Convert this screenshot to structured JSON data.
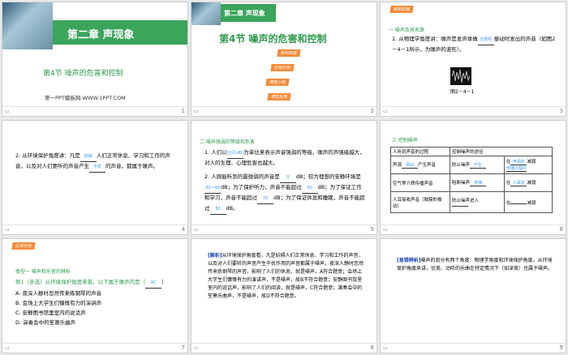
{
  "slides": [
    {
      "num": "1",
      "chapter": "第二章  声现象",
      "section": "第4节   噪声的危害和控制",
      "site": "第一PPT模板网-WWW.1PPT.COM"
    },
    {
      "num": "2",
      "chapter": "第二章 声现象",
      "section": "第4节    噪声的危害和控制",
      "tags": [
        "新知梳理",
        "应用示例",
        "课堂小结",
        "课堂反馈"
      ]
    },
    {
      "num": "3",
      "tag": "新知梳理",
      "subtitle": "一  噪声及其来源",
      "text1": "1. 从物理学角度讲：噪声是发声体做",
      "blank1": "无规则",
      "text2": "振动时发出的声音（如图2－4－1所示，为噪声的波形）。",
      "caption": "图2－4－1"
    },
    {
      "num": "4",
      "text1": "2. 从环境保护角度讲：凡是",
      "blank1": "妨碍",
      "text2": "人们正常休息、学习和工作的声音，以及对人们要听的声音产生",
      "blank2": "干扰",
      "text3": "的声音，都属于噪声。"
    },
    {
      "num": "5",
      "subtitle": "二  噪声强弱的等级和危害",
      "p1a": "1. 人们以",
      "p1b": "分贝(dB)",
      "p1c": "为单位来表示声音强弱的等级，噪声的声强级越大，对人的生理、心理危害也越大。",
      "p2a": "2. 人刚能听到的最微弱的声音是",
      "p2b": "0",
      "p2c": "dB；较为理想的安静环境是",
      "p2d": "30～40",
      "p2e": "dB；为了保护听力，声音不能超过",
      "p2f": "90",
      "p2g": "dB；为了保证工作和学习，声音不能超过",
      "p2h": "70",
      "p2i": "dB；为了保证休息和睡眠，声音不能超过",
      "p2j": "50",
      "p2k": "dB。"
    },
    {
      "num": "6",
      "subtitle": "三  控制噪声",
      "table": {
        "h1": "人听到声音的过程",
        "h2": "控制噪声的途径",
        "r1a": "声源",
        "r1a2": "振动",
        "r1a3": "产生声音",
        "r1b": "防止噪声",
        "r1b2": "产生",
        "r1c": "在",
        "r1c2": "声源处",
        "r1c3": "减弱",
        "r1c4": "传播过程中",
        "r2a": "空气等介质传播声音",
        "r2b": "阻断噪声",
        "r2b2": "传播",
        "r2c": "在",
        "r2c2": "人耳处",
        "r2c3": "减弱",
        "r3a": "人耳接收声音（鼓膜的振动）",
        "r3b": "防止噪声进入",
        "r3c": "在",
        "r3c3": "减弱"
      }
    },
    {
      "num": "7",
      "tag": "应用示例",
      "subtitle": "类型一   噪声和乐音的辨析",
      "q": "例1（多选）从环境保护角度来看，以下属于噪声的是（",
      "ans": "AC",
      "q2": "）",
      "opts": [
        "A. 夜深人静时忽然传来练钢琴的声音",
        "B. 会场上大学生们慷慨有力的演讲声",
        "C. 安静图书馆里室内的说话声",
        "D. 演奏会中的笙箫乐曲声"
      ]
    },
    {
      "num": "8",
      "label": "[解析]",
      "text": "从环境保护角度看，凡是妨碍人们正常休息、学习和工作的声音，以及对人们要听的声音产生干扰作用的声音都属于噪声。夜深人静时忽然传来练钢琴的声音，影响了人们的休息，就是噪声，A符合题意；会场上大学生们慷慨有力的演讲声，不是噪声，故B不符合题意；安静图书馆里室内的说话声，影响了人们的阅读，就是噪声，C符合题意；演奏会中的笙箫乐曲声，不是噪声，故D不符合题意。"
    },
    {
      "num": "9",
      "label": "[易错辨析]",
      "text": "噪声的划分有两个角度：物理学角度和环境保护角度。从环境保护角度来讲，优美、动听的乐曲在特定情况下（如深夜）也属于噪声。"
    }
  ],
  "colors": {
    "accent": "#3aa55b",
    "tag": "#f48b3a",
    "blank": "#3399ff"
  }
}
